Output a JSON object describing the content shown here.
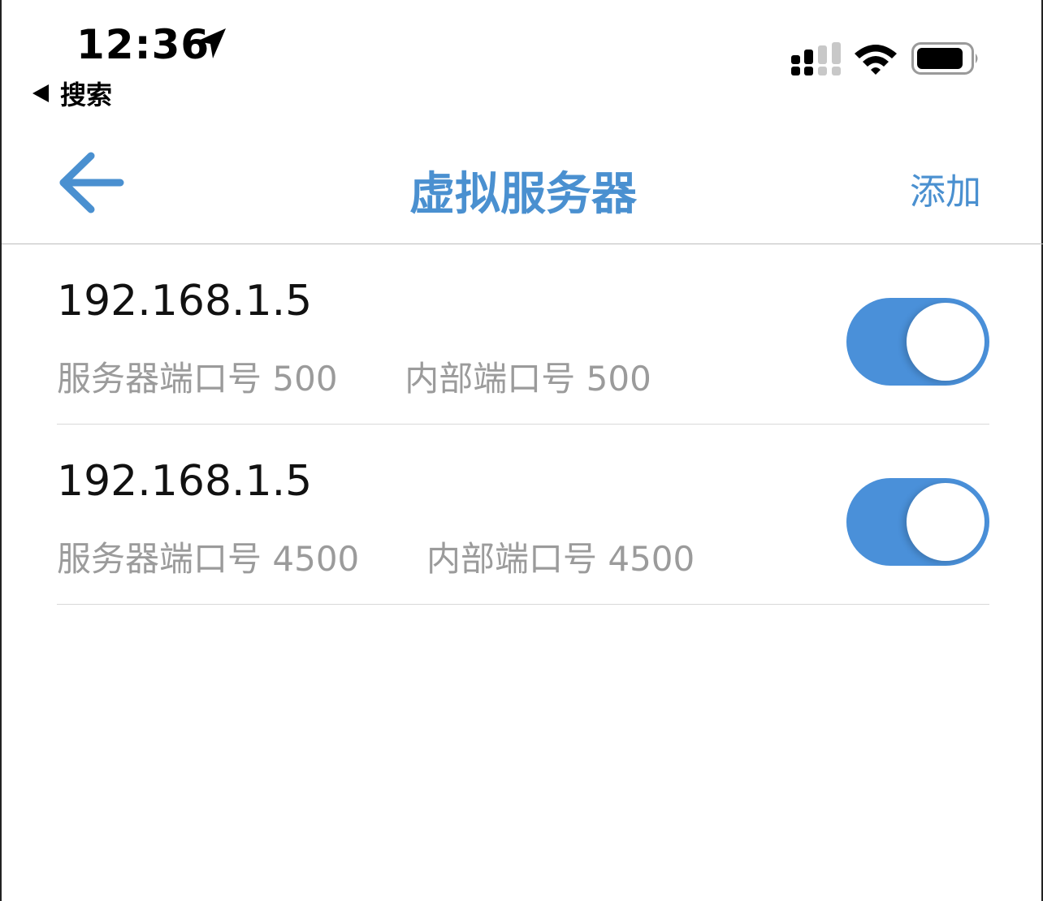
{
  "status_bar": {
    "time": "12:36",
    "back_app_label": "搜索",
    "icons": [
      "location-arrow-icon",
      "cellular-signal-icon",
      "wifi-icon",
      "battery-icon"
    ]
  },
  "nav": {
    "title": "虚拟服务器",
    "add_label": "添加",
    "back_icon": "back-arrow-icon",
    "accent_color": "#4a90d0"
  },
  "servers": [
    {
      "ip": "192.168.1.5",
      "server_port_label": "服务器端口号",
      "server_port": "500",
      "internal_port_label": "内部端口号",
      "internal_port": "500",
      "enabled": true
    },
    {
      "ip": "192.168.1.5",
      "server_port_label": "服务器端口号",
      "server_port": "4500",
      "internal_port_label": "内部端口号",
      "internal_port": "4500",
      "enabled": true
    }
  ]
}
